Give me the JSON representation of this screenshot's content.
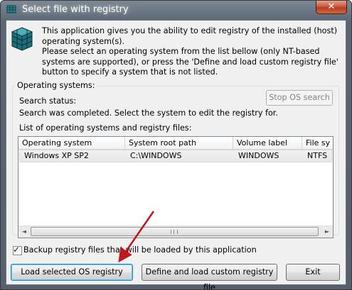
{
  "window": {
    "title": "Select file with registry",
    "close_glyph": "✕",
    "title_icon": "registry-icon"
  },
  "intro": {
    "line1": "This application gives you the ability to edit registry of the installed (host) operating system(s).",
    "line2": "Please select an operating system from the list bellow (only NT-based systems are supported), or press the 'Define and load custom registry file' button to specify a system that is not listed.",
    "icon": "registry-cube-icon"
  },
  "group": {
    "title": "Operating systems:",
    "search_status_label": "Search status:",
    "search_status_text": "Search was completed. Select the system to edit the registry for.",
    "stop_button": "Stop OS search",
    "list_label": "List of operating systems and registry files:"
  },
  "table": {
    "columns": [
      "Operating system",
      "System root path",
      "Volume label",
      "File sy"
    ],
    "rows": [
      [
        "Windows XP SP2",
        "C:\\WINDOWS",
        "WINDOWS",
        "NTFS"
      ]
    ]
  },
  "scrollbar": {
    "left_arrow": "◄",
    "right_arrow": "►"
  },
  "backup": {
    "checked": true,
    "label": "Backup registry files that will be loaded by this application"
  },
  "buttons": {
    "load": "Load selected OS registry",
    "define": "Define and load custom registry file",
    "exit": "Exit"
  },
  "colors": {
    "arrow": "#c0171f",
    "close_button": "#c85b40",
    "title_bar": "#5a6673"
  }
}
